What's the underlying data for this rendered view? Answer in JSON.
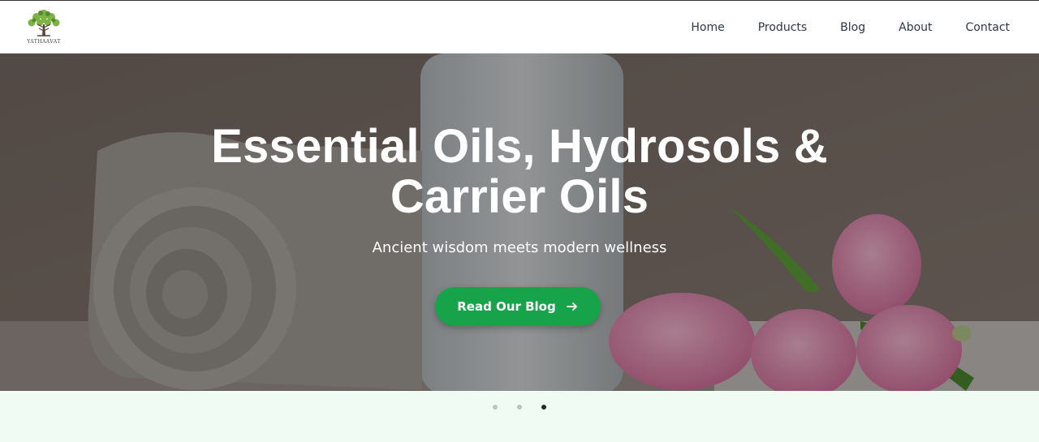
{
  "brand": {
    "logo_text": "YATHAAVAT",
    "logo_icon": "tree-logo-icon"
  },
  "nav": {
    "items": [
      {
        "label": "Home"
      },
      {
        "label": "Products"
      },
      {
        "label": "Blog"
      },
      {
        "label": "About"
      },
      {
        "label": "Contact"
      }
    ]
  },
  "hero": {
    "title_line1": "Essential Oils, Hydrosols &",
    "title_line2": "Carrier Oils",
    "subtitle": "Ancient wisdom meets modern wellness",
    "cta_label": "Read Our Blog",
    "cta_icon": "arrow-right-icon",
    "image_description_icon": "spa-background-image"
  },
  "carousel": {
    "slide_count": 3,
    "active_index": 2
  },
  "colors": {
    "accent": "#16a34a",
    "nav_text": "#2d3748",
    "page_bg": "#f0fbf3"
  }
}
